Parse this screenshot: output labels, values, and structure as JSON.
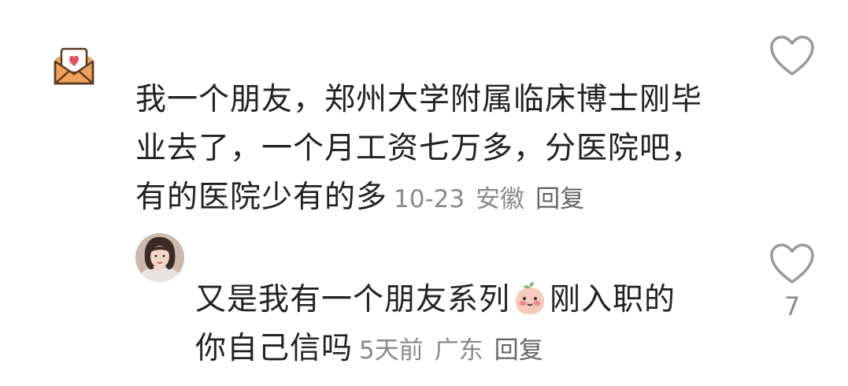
{
  "comments": [
    {
      "text": "我一个朋友，郑州大学附属临床博士刚毕业去了，一个月工资七万多，分医院吧，有的医院少有的多",
      "date": "10-23",
      "location": "安徽",
      "reply_label": "回复",
      "like_icon": "heart-outline-icon",
      "like_count": ""
    },
    {
      "text_before_emoji": "又是我有一个朋友系列",
      "emoji": "blushing-peach-emoji",
      "text_after_emoji": "刚入职的你自己信吗",
      "date": "5天前",
      "location": "广东",
      "reply_label": "回复",
      "like_icon": "heart-outline-icon",
      "like_count": "7"
    }
  ],
  "colors": {
    "text": "#222222",
    "meta": "#8a8a8a",
    "envelope_orange": "#f0a25a",
    "heart_red": "#e8505b"
  }
}
